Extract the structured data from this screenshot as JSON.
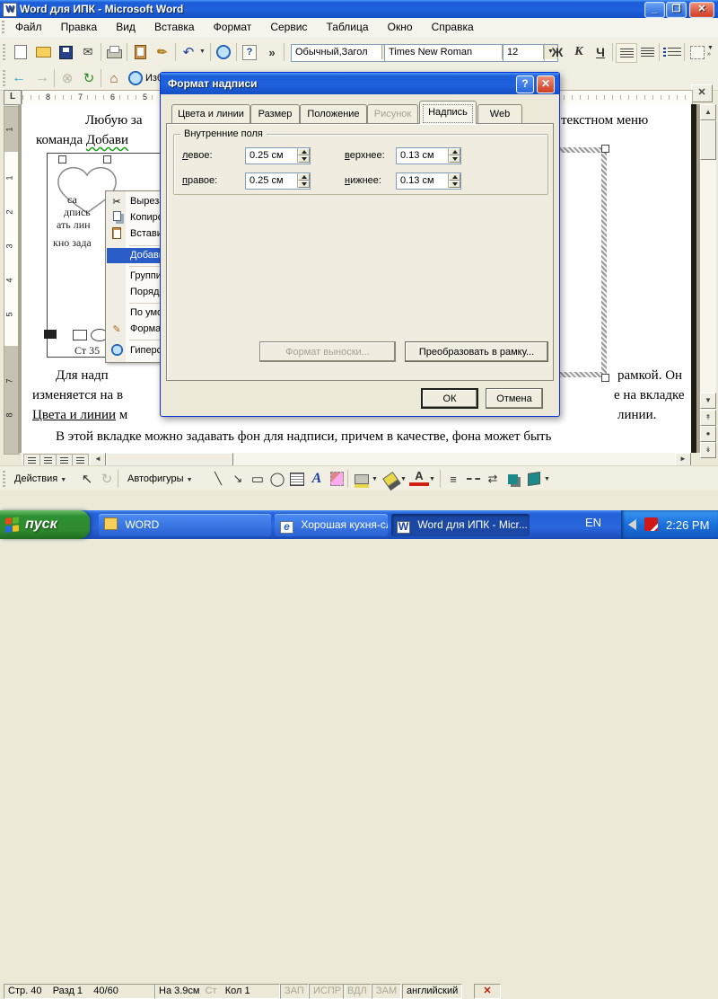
{
  "window": {
    "title": "Word для  ИПК - Microsoft Word"
  },
  "menu": {
    "items": [
      "Файл",
      "Правка",
      "Вид",
      "Вставка",
      "Формат",
      "Сервис",
      "Таблица",
      "Окно",
      "Справка"
    ]
  },
  "toolbar": {
    "style_combo": "Обычный,Загол",
    "font_combo": "Times New Roman",
    "size_combo": "12",
    "bold_label": "Ж",
    "italic_label": "К",
    "underline_label": "Ч"
  },
  "webbar": {
    "favorites_label": "Изб"
  },
  "ruler": {
    "tab_selector": "L",
    "h_numbers": [
      "8",
      "7",
      "6",
      "5"
    ],
    "v_top": "1",
    "v_mid": [
      "1",
      "2",
      "3",
      "4",
      "5"
    ],
    "v_bottom": [
      "7",
      "8"
    ]
  },
  "document": {
    "line1": "Любую за",
    "line2_prefix": "команда",
    "line2_word": "Добави",
    "line1_right": "текстном меню",
    "fragments": [
      "са",
      "дпись",
      "ать лин",
      "кно зада"
    ],
    "pic_caption": "Ст 35",
    "p2_left": [
      "Для надп",
      "изменяется на в"
    ],
    "p2_left_underlined": "Цвета и линии",
    "p2_left_rest": "м",
    "p2_right": [
      "рамкой. Он",
      "е на вкладке",
      "линии."
    ],
    "para3": "В этой вкладке можно задавать фон для надписи, причем в качестве, фона может быть"
  },
  "context_menu": {
    "items": [
      "Вырезать",
      "Копирова",
      "Вставить",
      "Добавить",
      "Группиро",
      "Порядок",
      "По умолч",
      "Формат а",
      "Гиперссы"
    ]
  },
  "dialog": {
    "title": "Формат надписи",
    "tabs": [
      "Цвета и линии",
      "Размер",
      "Положение",
      "Рисунок",
      "Надпись",
      "Web"
    ],
    "group_title": "Внутренние поля",
    "fields": {
      "left_label": "левое:",
      "left_value": "0.25 см",
      "top_label": "верхнее:",
      "top_value": "0.13 см",
      "right_label": "правое:",
      "right_value": "0.25 см",
      "bottom_label": "нижнее:",
      "bottom_value": "0.13 см"
    },
    "callout_button": "Формат выноски...",
    "convert_button": "Преобразовать в рамку...",
    "ok_button": "ОК",
    "cancel_button": "Отмена"
  },
  "drawing": {
    "actions_label": "Действия",
    "autoshapes_label": "Автофигуры"
  },
  "status": {
    "page": "Стр. 40",
    "section": "Разд 1",
    "position": "40/60",
    "at": "На 3.9см",
    "line": "Ст",
    "column": "Кол 1",
    "rec": "ЗАП",
    "track": "ИСПР",
    "ext": "ВДЛ",
    "ovr": "ЗАМ",
    "language": "английский"
  },
  "taskbar": {
    "start_label": "пуск",
    "tasks": [
      "WORD",
      "Хорошая кухня-слое",
      "Word для ИПК - Micr..."
    ],
    "language_indicator": "EN",
    "clock": "2:26 PM"
  }
}
